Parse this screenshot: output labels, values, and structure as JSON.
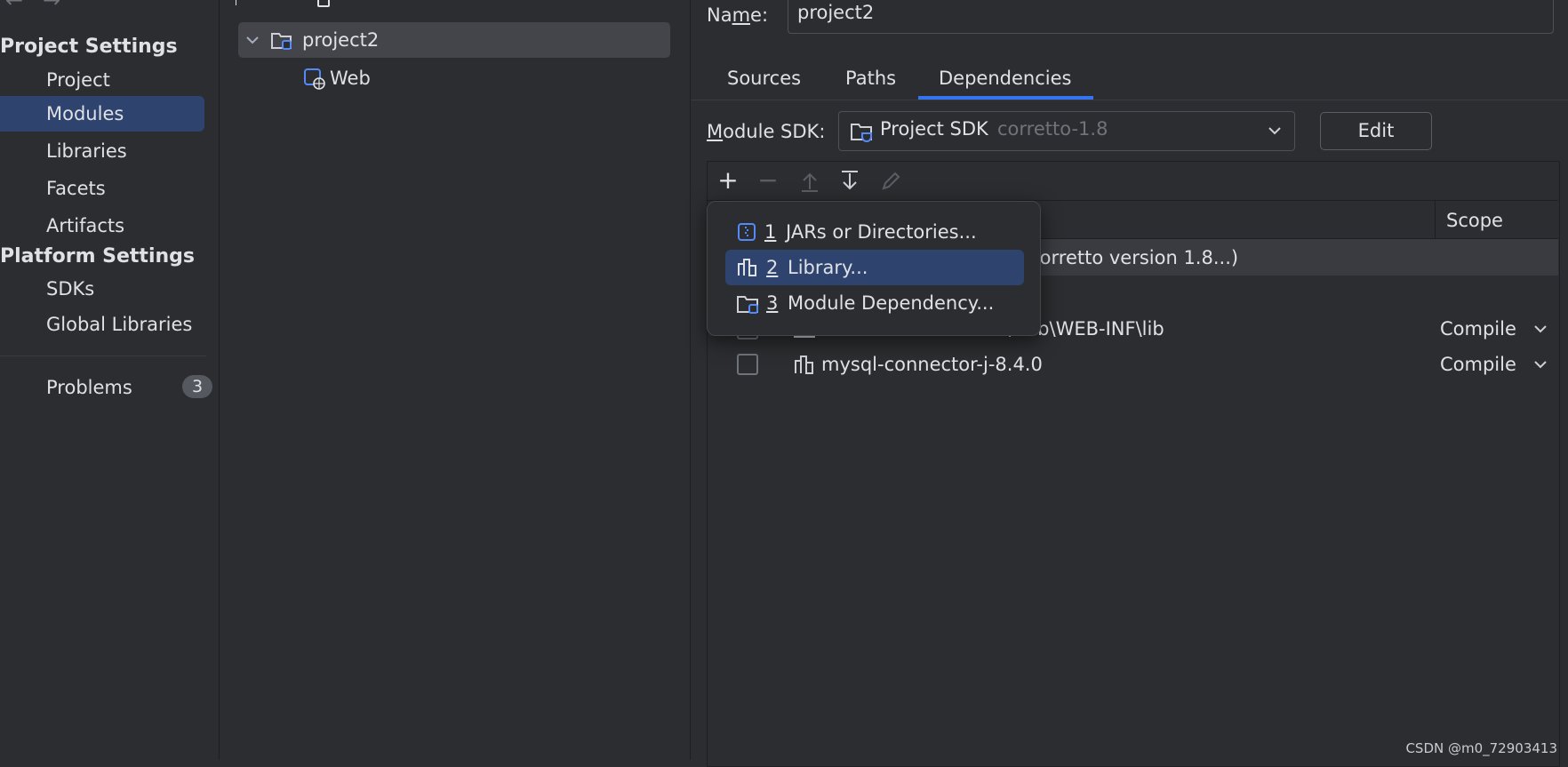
{
  "sidebar": {
    "back_arrow": "←",
    "forward_arrow": "→",
    "project_settings_label": "Project Settings",
    "project_items": [
      {
        "label": "Project"
      },
      {
        "label": "Modules"
      },
      {
        "label": "Libraries"
      },
      {
        "label": "Facets"
      },
      {
        "label": "Artifacts"
      }
    ],
    "platform_settings_label": "Platform Settings",
    "platform_items": [
      {
        "label": "SDKs"
      },
      {
        "label": "Global Libraries"
      }
    ],
    "problems_label": "Problems",
    "problems_count": "3"
  },
  "tree": {
    "root_label": "project2",
    "child_label": "Web"
  },
  "detail": {
    "name_label_prefix": "Na",
    "name_label_mnemonic": "m",
    "name_label_suffix": "e:",
    "name_value": "project2",
    "tabs": [
      {
        "label": "Sources"
      },
      {
        "label": "Paths"
      },
      {
        "label": "Dependencies"
      }
    ],
    "sdk_label_mnemonic": "M",
    "sdk_label_rest": "odule SDK:",
    "sdk_value": "Project SDK",
    "sdk_value_hint": "corretto-1.8",
    "edit_button": "Edit",
    "scope_header": "Scope",
    "sdk_row_text": "Corretto version 1.8...)",
    "rows": [
      {
        "name": "\\web\\WEB-INF\\lib",
        "scope": "Compile"
      },
      {
        "name": "mysql-connector-j-8.4.0",
        "scope": "Compile"
      }
    ]
  },
  "popup": {
    "items": [
      {
        "num": "1",
        "label": "JARs or Directories..."
      },
      {
        "num": "2",
        "label": "Library..."
      },
      {
        "num": "3",
        "label": "Module Dependency..."
      }
    ]
  },
  "watermark": "CSDN @m0_72903413",
  "colors": {
    "background": "#2b2d30",
    "selection": "#2e436e",
    "accent": "#3574f0",
    "text": "#dfe1e5",
    "muted": "#6f737a"
  }
}
